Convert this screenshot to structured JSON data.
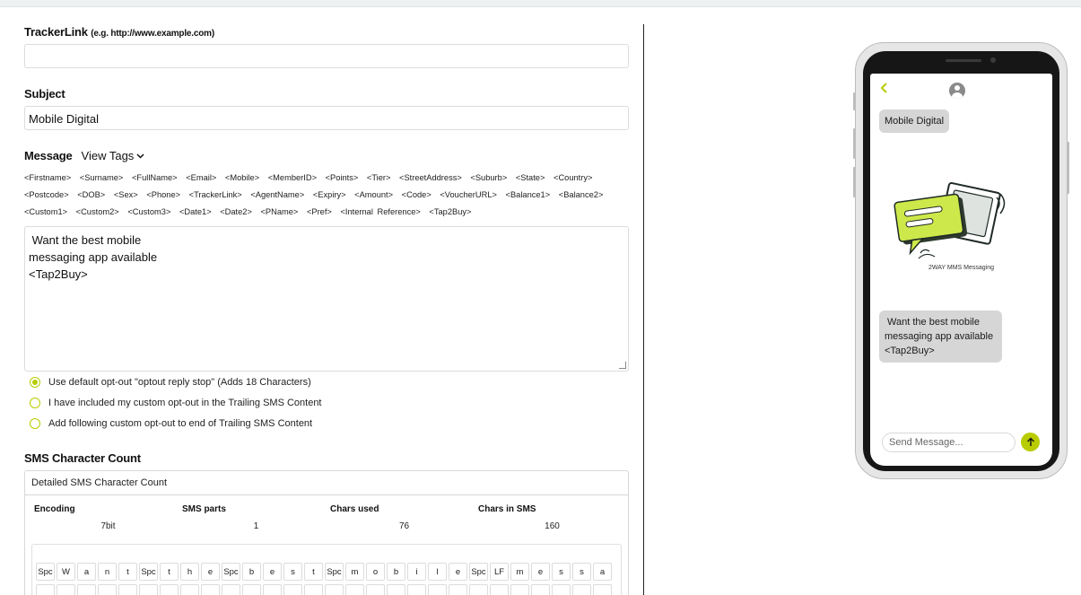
{
  "form": {
    "tracker_label": "TrackerLink",
    "tracker_hint": "(e.g. http://www.example.com)",
    "tracker_value": "",
    "subject_label": "Subject",
    "subject_value": "Mobile Digital",
    "message_label": "Message",
    "view_tags_label": "View Tags",
    "tags": [
      "<Firstname>",
      "<Surname>",
      "<FullName>",
      "<Email>",
      "<Mobile>",
      "<MemberID>",
      "<Points>",
      "<Tier>",
      "<StreetAddress>",
      "<Suburb>",
      "<State>",
      "<Country>",
      "<Postcode>",
      "<DOB>",
      "<Sex>",
      "<Phone>",
      "<TrackerLink>",
      "<AgentName>",
      "<Expiry>",
      "<Amount>",
      "<Code>",
      "<VoucherURL>",
      "<Balance1>",
      "<Balance2>",
      "<Custom1>",
      "<Custom2>",
      "<Custom3>",
      "<Date1>",
      "<Date2>",
      "<PName>",
      "<Pref>",
      "<Internal Reference>",
      "<Tap2Buy>"
    ],
    "message_lines": [
      " Want the best mobile",
      "messaging app available",
      "<Tap2Buy>"
    ],
    "optout_options": [
      {
        "label": "Use default opt-out \"optout reply stop\" (Adds 18 Characters)",
        "selected": true
      },
      {
        "label": "I have included my custom opt-out in the Trailing SMS Content",
        "selected": false
      },
      {
        "label": "Add following custom opt-out to end of Trailing SMS Content",
        "selected": false
      }
    ]
  },
  "sms_count": {
    "section_label": "SMS Character Count",
    "box_title": "Detailed SMS Character Count",
    "headers": [
      "Encoding",
      "SMS parts",
      "Chars used",
      "Chars in SMS"
    ],
    "values": [
      "7bit",
      "1",
      "76",
      "160"
    ],
    "chars_row1": [
      "Spc",
      "W",
      "a",
      "n",
      "t",
      "Spc",
      "t",
      "h",
      "e",
      "Spc",
      "b",
      "e",
      "s",
      "t",
      "Spc",
      "m",
      "o",
      "b",
      "i",
      "l",
      "e",
      "Spc",
      "LF",
      "m",
      "e",
      "s",
      "s",
      "a"
    ]
  },
  "preview": {
    "subject_bubble": "Mobile Digital",
    "image_caption": "2WAY MMS Messaging",
    "message_bubble_lines": [
      " Want the best mobile",
      "messaging app available",
      "<Tap2Buy>"
    ],
    "send_placeholder": "Send Message...",
    "back_icon": "chevron-left-icon",
    "accent_color": "#b8cc00"
  }
}
